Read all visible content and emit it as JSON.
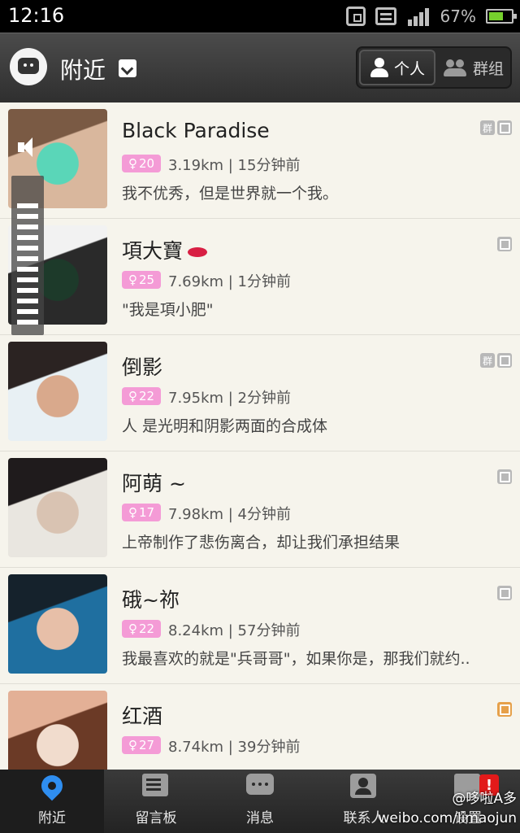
{
  "status_bar": {
    "time": "12:16",
    "battery_percent": "67%",
    "battery_level": 0.67
  },
  "header": {
    "title": "附近",
    "segment": {
      "personal": "个人",
      "group": "群组",
      "active": "personal"
    }
  },
  "list": [
    {
      "nickname": "Black Paradise",
      "age": "20",
      "distance_time": "3.19km | 15分钟前",
      "signature": "我不优秀，但是世界就一个我。",
      "tags": [
        "group-tag-icon",
        "photo-tag-icon"
      ],
      "avatar_colors": [
        "#d9b79d",
        "#7a5a44",
        "#5ad6b8"
      ]
    },
    {
      "nickname": "項大寶",
      "age": "25",
      "distance_time": "7.69km | 1分钟前",
      "signature": "\"我是項小肥\"",
      "tags": [
        "photo-tag-icon"
      ],
      "avatar_colors": [
        "#2a2a2a",
        "#f2f2f2",
        "#1d3a2a"
      ]
    },
    {
      "nickname": "倒影",
      "age": "22",
      "distance_time": "7.95km | 2分钟前",
      "signature": "人 是光明和阴影两面的合成体",
      "tags": [
        "group-tag-icon",
        "photo-tag-icon"
      ],
      "avatar_colors": [
        "#e8f0f4",
        "#2b2322",
        "#d9a98c"
      ]
    },
    {
      "nickname": "阿萌 ~",
      "age": "17",
      "distance_time": "7.98km | 4分钟前",
      "signature": "上帝制作了悲伤离合，却让我们承担结果",
      "tags": [
        "photo-tag-icon"
      ],
      "avatar_colors": [
        "#e9e6e0",
        "#1f1b1c",
        "#d9c3b2"
      ]
    },
    {
      "nickname": "硪~祢",
      "age": "22",
      "distance_time": "8.24km | 57分钟前",
      "signature": "我最喜欢的就是\"兵哥哥\"，如果你是，那我们就约..",
      "tags": [
        "photo-tag-icon"
      ],
      "avatar_colors": [
        "#1f6fa0",
        "#15222c",
        "#e7bfa8"
      ]
    },
    {
      "nickname": "红酒",
      "age": "27",
      "distance_time": "8.74km | 39分钟前",
      "signature": "",
      "tags": [
        "badge-tag-icon"
      ],
      "avatar_colors": [
        "#6b3a26",
        "#e3b096",
        "#f1dccd"
      ]
    }
  ],
  "volume_level": 0.85,
  "bottom_nav": [
    {
      "label": "附近",
      "icon": "location-pin-icon",
      "active": true
    },
    {
      "label": "留言板",
      "icon": "message-board-icon"
    },
    {
      "label": "消息",
      "icon": "chat-bubble-icon"
    },
    {
      "label": "联系人",
      "icon": "contacts-icon"
    },
    {
      "label": "设置",
      "icon": "calendar-icon",
      "alert": "!"
    }
  ],
  "watermark": {
    "line1": "@哆啦A多",
    "line2": "weibo.com/limaojun"
  },
  "colors": {
    "accent_blue": "#2f8ef0",
    "age_badge_pink": "#f49bd6",
    "battery_green": "#76d12d",
    "alert_red": "#e21a1a"
  }
}
